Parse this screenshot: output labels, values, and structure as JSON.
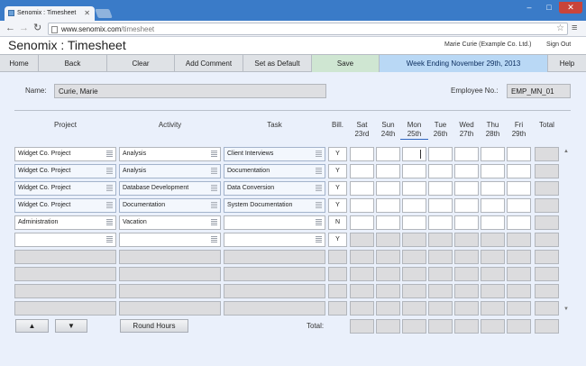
{
  "browser": {
    "tab_title": "Senomix : Timesheet",
    "url_host": "www.senomix.com",
    "url_path": "/timesheet"
  },
  "app": {
    "title": "Senomix : Timesheet",
    "user": "Marie Curie  (Example Co. Ltd.)",
    "sign_out": "Sign Out"
  },
  "actions": {
    "home": "Home",
    "back": "Back",
    "clear": "Clear",
    "add_comment": "Add Comment",
    "set_default": "Set as Default",
    "save": "Save",
    "week_ending": "Week Ending November 29th, 2013",
    "help": "Help"
  },
  "employee": {
    "name_label": "Name:",
    "name": "Curie, Marie",
    "number_label": "Employee No.:",
    "number": "EMP_MN_01"
  },
  "columns": {
    "project": "Project",
    "activity": "Activity",
    "task": "Task",
    "billable": "Bill.",
    "days": [
      {
        "dow": "Sat",
        "date": "23rd"
      },
      {
        "dow": "Sun",
        "date": "24th"
      },
      {
        "dow": "Mon",
        "date": "25th"
      },
      {
        "dow": "Tue",
        "date": "26th"
      },
      {
        "dow": "Wed",
        "date": "27th"
      },
      {
        "dow": "Thu",
        "date": "28th"
      },
      {
        "dow": "Fri",
        "date": "29th"
      }
    ],
    "total": "Total"
  },
  "rows": [
    {
      "project": "Widget Co. Project",
      "activity": "Analysis",
      "task": "Client Interviews",
      "billable": "Y"
    },
    {
      "project": "Widget Co. Project",
      "activity": "Analysis",
      "task": "Documentation",
      "billable": "Y"
    },
    {
      "project": "Widget Co. Project",
      "activity": "Database Development",
      "task": "Data Conversion",
      "billable": "Y"
    },
    {
      "project": "Widget Co. Project",
      "activity": "Documentation",
      "task": "System Documentation",
      "billable": "Y"
    },
    {
      "project": "Administration",
      "activity": "Vacation",
      "task": "",
      "billable": "N"
    },
    {
      "project": "",
      "activity": "",
      "task": "",
      "billable": "Y"
    },
    {
      "project": "",
      "activity": "",
      "task": "",
      "billable": ""
    },
    {
      "project": "",
      "activity": "",
      "task": "",
      "billable": ""
    },
    {
      "project": "",
      "activity": "",
      "task": "",
      "billable": ""
    },
    {
      "project": "",
      "activity": "",
      "task": "",
      "billable": ""
    }
  ],
  "footer": {
    "move_up": "▲",
    "move_down": "▼",
    "round_hours": "Round Hours",
    "total_label": "Total:"
  },
  "colors": {
    "accent": "#b9d8f5",
    "save": "#cfe6d2",
    "page_bg": "#eaf0fb"
  }
}
